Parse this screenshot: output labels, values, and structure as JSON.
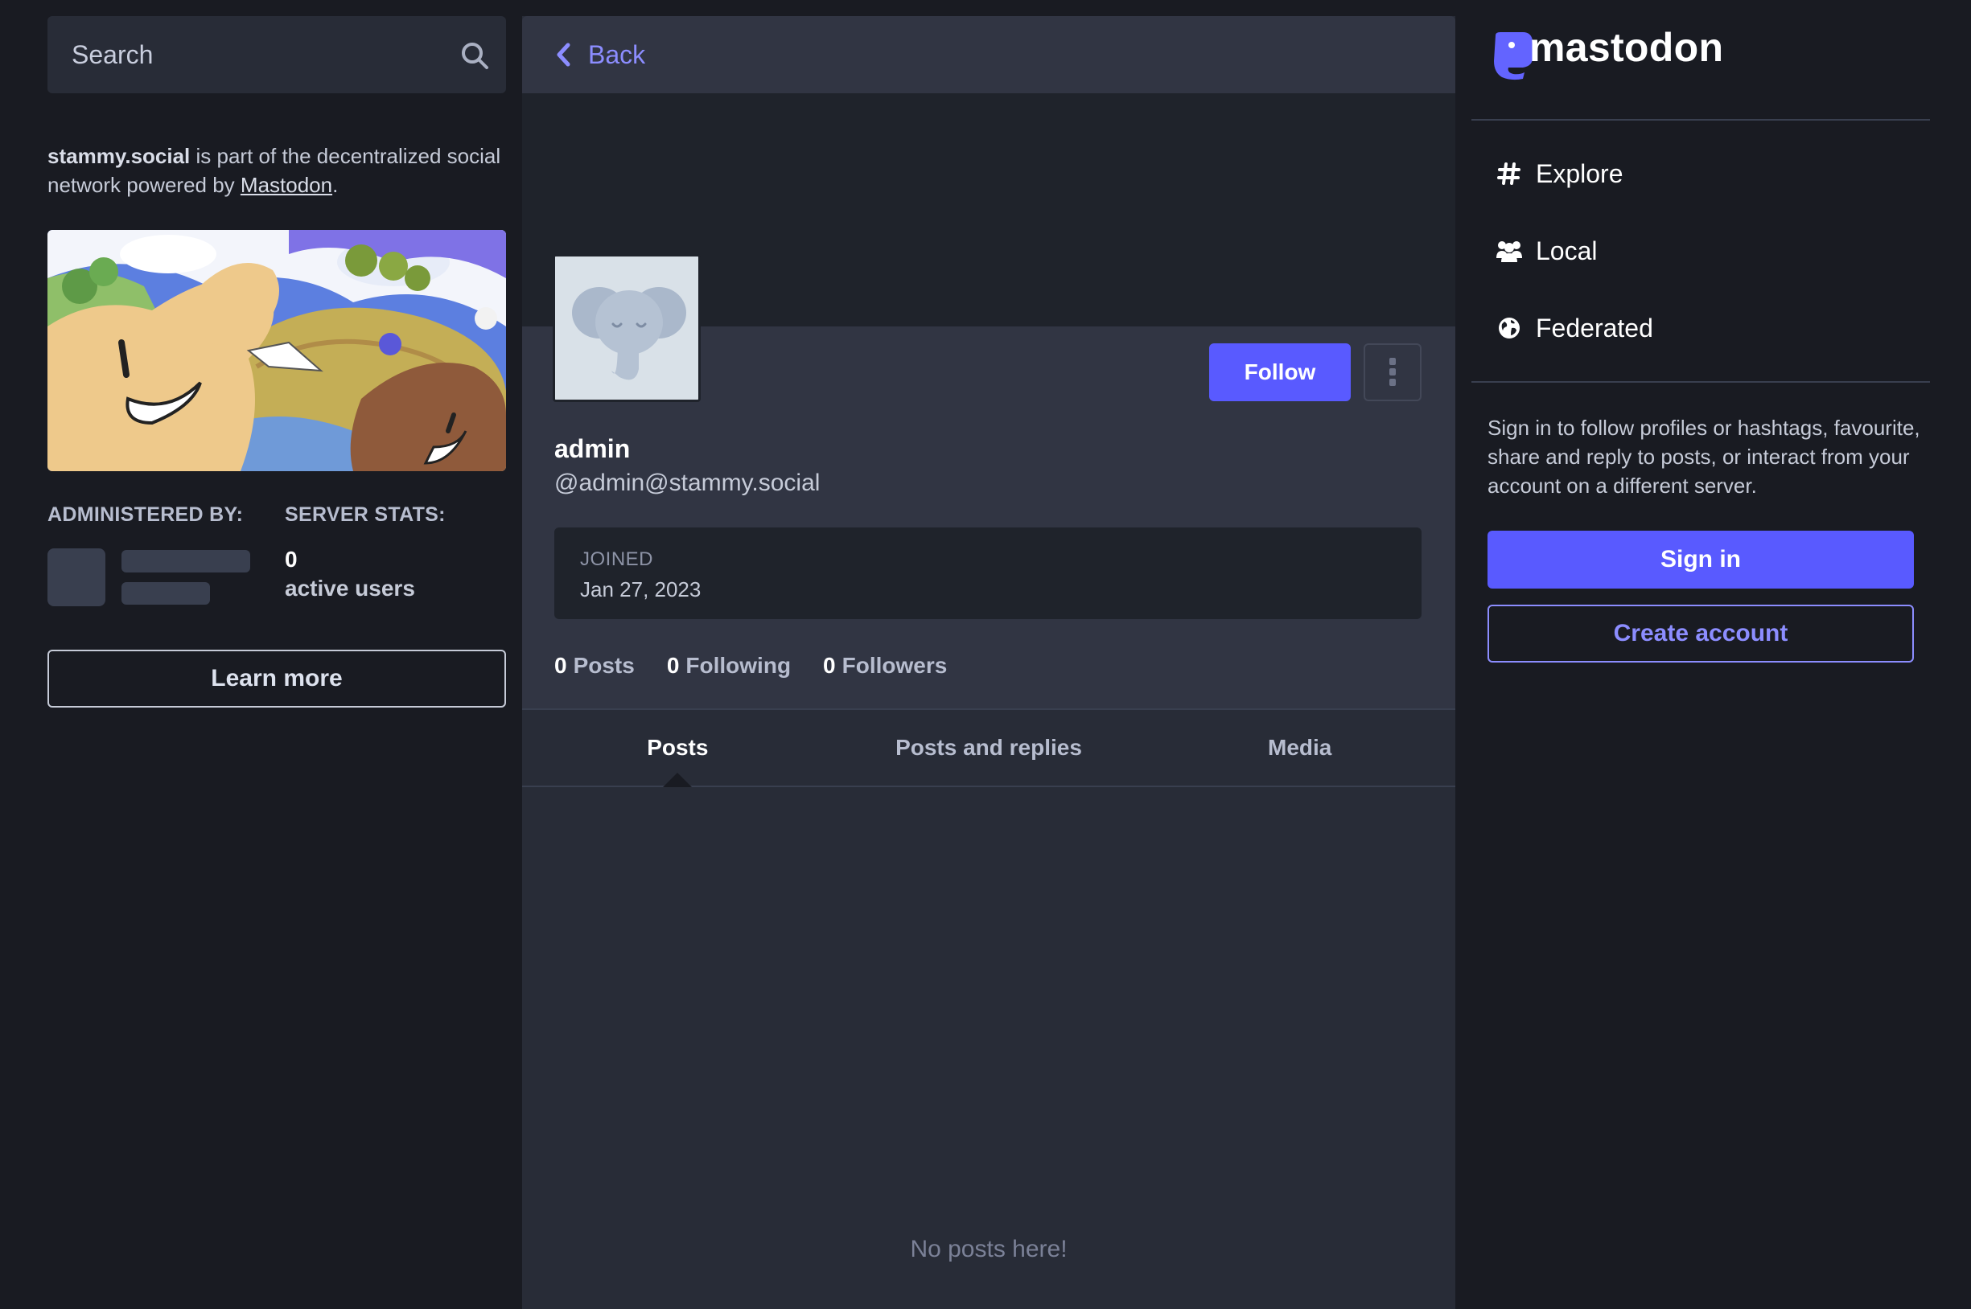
{
  "search": {
    "placeholder": "Search"
  },
  "about": {
    "server": "stammy.social",
    "text_mid": " is part of the decentralized social network powered by ",
    "link": "Mastodon",
    "text_end": "."
  },
  "admin_section": {
    "title": "ADMINISTERED BY:"
  },
  "stats_section": {
    "title": "SERVER STATS:",
    "active_users_value": "0",
    "active_users_label": "active users"
  },
  "learn_more_label": "Learn more",
  "header": {
    "back_label": "Back"
  },
  "profile": {
    "follow_label": "Follow",
    "display_name": "admin",
    "handle": "@admin@stammy.social",
    "joined_label": "JOINED",
    "joined_date": "Jan 27, 2023",
    "counts": [
      {
        "value": "0",
        "label": "Posts"
      },
      {
        "value": "0",
        "label": "Following"
      },
      {
        "value": "0",
        "label": "Followers"
      }
    ]
  },
  "tabs": [
    {
      "label": "Posts",
      "active": true
    },
    {
      "label": "Posts and replies",
      "active": false
    },
    {
      "label": "Media",
      "active": false
    }
  ],
  "empty_message": "No posts here!",
  "brand": {
    "name": "mastodon"
  },
  "nav": [
    {
      "label": "Explore",
      "icon": "hashtag-icon"
    },
    {
      "label": "Local",
      "icon": "users-icon"
    },
    {
      "label": "Federated",
      "icon": "globe-icon"
    }
  ],
  "signin": {
    "prompt": "Sign in to follow profiles or hashtags, favourite, share and reply to posts, or interact from your account on a different server.",
    "signin_label": "Sign in",
    "create_label": "Create account"
  },
  "colors": {
    "accent": "#595aff",
    "link": "#8c8dff",
    "background": "#191b22",
    "panel": "#282c37"
  }
}
